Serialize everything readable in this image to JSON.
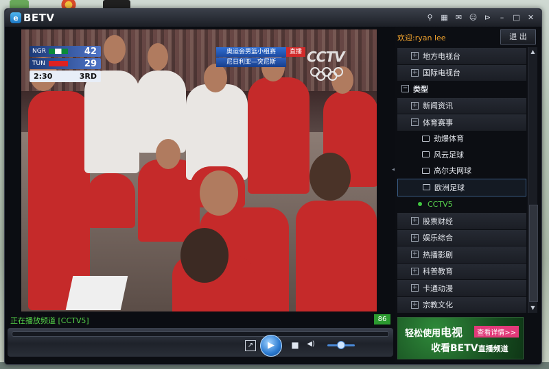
{
  "app": {
    "name": "BETV",
    "logo_badge": "e"
  },
  "title_icons": [
    "search-icon",
    "skin-icon",
    "chat-icon",
    "user-icon",
    "pin-icon",
    "minimize-icon",
    "maximize-icon",
    "close-icon"
  ],
  "title_icon_glyphs": [
    "⚲",
    "▦",
    "✉",
    "☺",
    "⊳",
    "–",
    "□",
    "✕"
  ],
  "broadcast": {
    "team1": "NGR",
    "team1_score": "42",
    "team2": "TUN",
    "team2_score": "29",
    "clock": "2:30",
    "quarter": "3RD",
    "banner_line1": "奥运会男篮小组赛",
    "banner_line2": "尼日利亚—突尼斯",
    "live": "直播",
    "channel_logo": "CCTV"
  },
  "status": {
    "text": "正在播放频道 [CCTV5]",
    "volume_badge": "86"
  },
  "controls": {
    "screen_icon": "↗",
    "play_icon": "▶",
    "stop_icon": "■",
    "volume_icon": "◀)"
  },
  "sidebar": {
    "welcome": "欢迎:ryan lee",
    "logout": "退 出",
    "tree": [
      {
        "label": "地方电视台",
        "level": 1,
        "toggle": "+"
      },
      {
        "label": "国际电视台",
        "level": 1,
        "toggle": "+"
      },
      {
        "label": "类型",
        "level": 0,
        "toggle": "−"
      },
      {
        "label": "新闻资讯",
        "level": 1,
        "toggle": "+"
      },
      {
        "label": "体育赛事",
        "level": 1,
        "toggle": "−"
      },
      {
        "label": "劲爆体育",
        "level": 2
      },
      {
        "label": "风云足球",
        "level": 2
      },
      {
        "label": "高尔夫网球",
        "level": 2
      },
      {
        "label": "欧洲足球",
        "level": 2,
        "state": "selected"
      },
      {
        "label": "CCTV5",
        "level": 2,
        "state": "playing"
      },
      {
        "label": "股票财经",
        "level": 1,
        "toggle": "+"
      },
      {
        "label": "娱乐综合",
        "level": 1,
        "toggle": "+"
      },
      {
        "label": "热播影剧",
        "level": 1,
        "toggle": "+"
      },
      {
        "label": "科普教育",
        "level": 1,
        "toggle": "+"
      },
      {
        "label": "卡通动漫",
        "level": 1,
        "toggle": "+"
      },
      {
        "label": "宗教文化",
        "level": 1,
        "toggle": "+"
      }
    ],
    "ad": {
      "line1_prefix": "轻松使用",
      "line1_big": "电视",
      "link": "查看详情>>",
      "line2_prefix": "收看",
      "line2_big": "BETV",
      "line2_suffix": "直播频道"
    },
    "scroll_up": "▲",
    "scroll_down": "▼",
    "splitter_arrow": "◀"
  }
}
